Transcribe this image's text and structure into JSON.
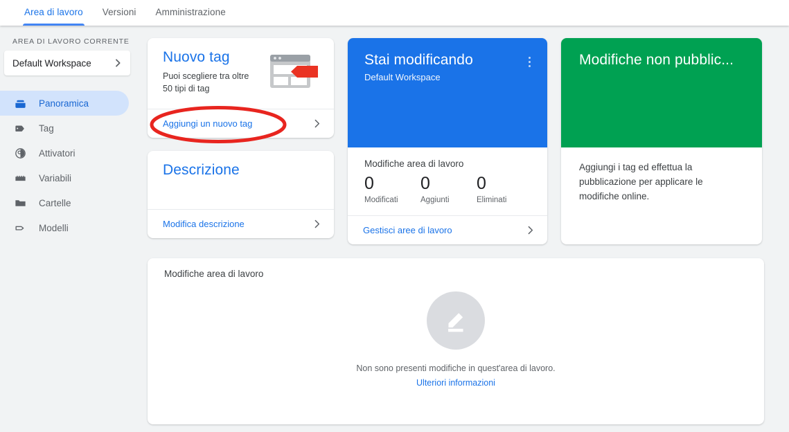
{
  "colors": {
    "accent_blue": "#1a73e8",
    "tab_underline": "#4285f4",
    "active_nav_bg": "#d2e3fc",
    "active_nav_text": "#1967d2",
    "green_card": "#00a152",
    "annotation_red": "#e8251f",
    "tag_red": "#ea3323",
    "page_bg": "#f1f3f4",
    "muted_text": "#5f6368"
  },
  "tabs": [
    {
      "label": "Area di lavoro",
      "active": true
    },
    {
      "label": "Versioni",
      "active": false
    },
    {
      "label": "Amministrazione",
      "active": false
    }
  ],
  "sidebar": {
    "section_label": "AREA DI LAVORO CORRENTE",
    "workspace_selector": {
      "name": "Default Workspace",
      "chevron_icon": "chevron-right-icon"
    },
    "items": [
      {
        "label": "Panoramica",
        "icon": "overview-box-icon",
        "active": true
      },
      {
        "label": "Tag",
        "icon": "tag-filled-icon",
        "active": false
      },
      {
        "label": "Attivatori",
        "icon": "trigger-circle-icon",
        "active": false
      },
      {
        "label": "Variabili",
        "icon": "variables-icon",
        "active": false
      },
      {
        "label": "Cartelle",
        "icon": "folder-icon",
        "active": false
      },
      {
        "label": "Modelli",
        "icon": "template-tag-outline-icon",
        "active": false
      }
    ]
  },
  "cards": {
    "new_tag": {
      "title": "Nuovo tag",
      "description_line1": "Puoi scegliere tra oltre",
      "description_line2": "50 tipi di tag",
      "illustration_icon": "browser-tag-illustration",
      "footer_link": "Aggiungi un nuovo tag",
      "footer_chevron_icon": "chevron-right-icon"
    },
    "description": {
      "title": "Descrizione",
      "footer_link": "Modifica descrizione",
      "footer_chevron_icon": "chevron-right-icon"
    },
    "editing": {
      "title": "Stai modificando",
      "subtitle": "Default Workspace",
      "menu_icon": "kebab-menu-icon",
      "changes_title": "Modifiche area di lavoro",
      "stats": [
        {
          "value": "0",
          "label": "Modificati"
        },
        {
          "value": "0",
          "label": "Aggiunti"
        },
        {
          "value": "0",
          "label": "Eliminati"
        }
      ],
      "footer_link": "Gestisci aree di lavoro",
      "footer_chevron_icon": "chevron-right-icon"
    },
    "unpublished": {
      "title": "Modifiche non pubblic...",
      "body": "Aggiungi i tag ed effettua la pubblicazione per applicare le modifiche online."
    }
  },
  "changes_panel": {
    "title": "Modifiche area di lavoro",
    "empty_icon": "pencil-edit-icon",
    "empty_message": "Non sono presenti modifiche in quest'area di lavoro.",
    "learn_more_link": "Ulteriori informazioni"
  },
  "annotation": {
    "shape": "red-ellipse-highlight",
    "targets": "Aggiungi un nuovo tag"
  }
}
